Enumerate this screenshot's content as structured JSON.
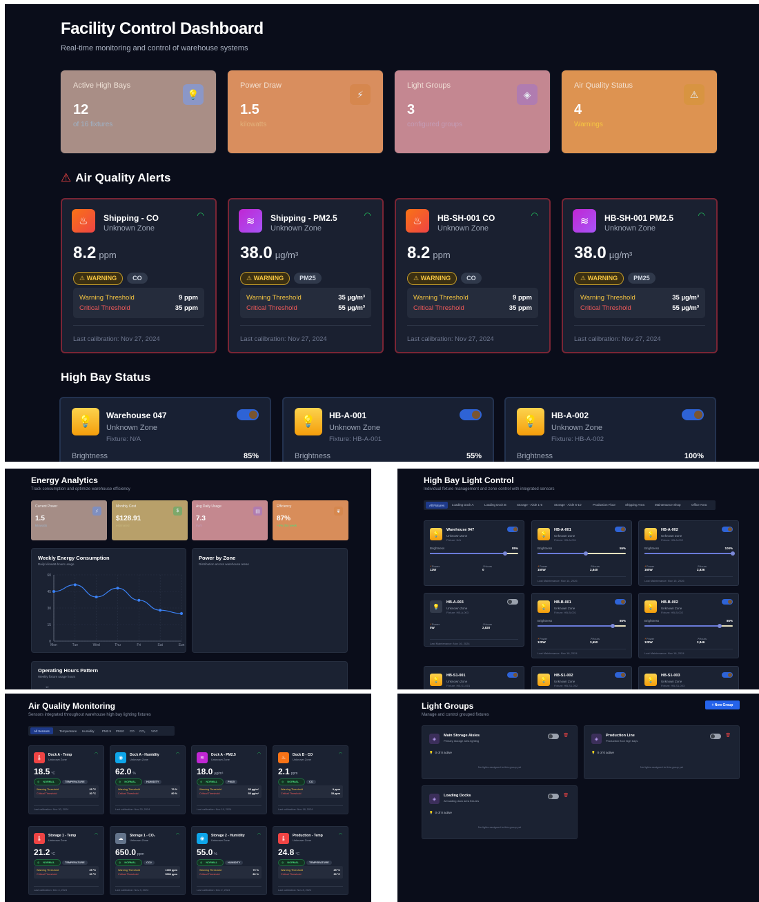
{
  "dashboard": {
    "title": "Facility Control Dashboard",
    "subtitle": "Real-time monitoring and control of warehouse systems",
    "stats": [
      {
        "label": "Active High Bays",
        "value": "12",
        "sub": "of 16 fixtures",
        "icon": "lightbulb-icon",
        "bg": "#a98e86",
        "subColor": "#9fb2c6",
        "iconBg": "#8b97c7"
      },
      {
        "label": "Power Draw",
        "value": "1.5",
        "sub": "kilowatts",
        "icon": "lightning-icon",
        "bg": "#d98e5e",
        "subColor": "#e2b07a",
        "iconBg": "#d6874e"
      },
      {
        "label": "Light Groups",
        "value": "3",
        "sub": "configured groups",
        "icon": "layers-icon",
        "bg": "#c48791",
        "subColor": "#c59cb5",
        "iconBg": "#b07cb0"
      },
      {
        "label": "Air Quality Status",
        "value": "4",
        "sub": "Warnings",
        "icon": "warning-icon",
        "bg": "#dd9351",
        "subColor": "#f5c542",
        "iconBg": "#d89441"
      }
    ]
  },
  "alerts": {
    "title": "Air Quality Alerts",
    "items": [
      {
        "name": "Shipping - CO",
        "zone": "Unknown Zone",
        "value": "8.2",
        "unit": "ppm",
        "status": "WARNING",
        "type": "CO",
        "warn": "9 ppm",
        "crit": "35 ppm",
        "cal": "Last calibration: Nov 27, 2024",
        "kind": "flame"
      },
      {
        "name": "Shipping - PM2.5",
        "zone": "Unknown Zone",
        "value": "38.0",
        "unit": "µg/m³",
        "status": "WARNING",
        "type": "PM25",
        "warn": "35 µg/m³",
        "crit": "55 µg/m³",
        "cal": "Last calibration: Nov 27, 2024",
        "kind": "wind"
      },
      {
        "name": "HB-SH-001 CO",
        "zone": "Unknown Zone",
        "value": "8.2",
        "unit": "ppm",
        "status": "WARNING",
        "type": "CO",
        "warn": "9 ppm",
        "crit": "35 ppm",
        "cal": "Last calibration: Nov 27, 2024",
        "kind": "flame"
      },
      {
        "name": "HB-SH-001 PM2.5",
        "zone": "Unknown Zone",
        "value": "38.0",
        "unit": "µg/m³",
        "status": "WARNING",
        "type": "PM25",
        "warn": "35 µg/m³",
        "crit": "55 µg/m³",
        "cal": "Last calibration: Nov 27, 2024",
        "kind": "wind"
      }
    ],
    "warnLabel": "Warning Threshold",
    "critLabel": "Critical Threshold"
  },
  "highbay": {
    "title": "High Bay Status",
    "brightnessLabel": "Brightness",
    "items": [
      {
        "name": "Warehouse 047",
        "zone": "Unknown Zone",
        "fixture": "Fixture: N/A",
        "brightness": "85%"
      },
      {
        "name": "HB-A-001",
        "zone": "Unknown Zone",
        "fixture": "Fixture: HB-A-001",
        "brightness": "55%"
      },
      {
        "name": "HB-A-002",
        "zone": "Unknown Zone",
        "fixture": "Fixture: HB-A-002",
        "brightness": "100%"
      }
    ]
  },
  "energy": {
    "title": "Energy Analytics",
    "subtitle": "Track consumption and optimize warehouse efficiency",
    "stats": [
      {
        "label": "Current Power",
        "value": "1.5",
        "sub": "kilowatts",
        "bg": "#a58d86",
        "icon": "lightning-icon",
        "iconBg": "#7f8fc0",
        "subColor": "#9fb2c6"
      },
      {
        "label": "Monthly Cost",
        "value": "$128.91",
        "sub": "estimated",
        "bg": "#b8a06a",
        "icon": "dollar-icon",
        "iconBg": "#7da86a",
        "subColor": "#c8b880"
      },
      {
        "label": "Avg Daily Usage",
        "value": "7.3",
        "sub": "kWh",
        "bg": "#c4888f",
        "icon": "chart-icon",
        "iconBg": "#b07cb0",
        "subColor": "#c59cb5"
      },
      {
        "label": "Efficiency",
        "value": "87%",
        "sub": "+5% this week",
        "bg": "#d88d5a",
        "icon": "leaf-icon",
        "iconBg": "#d6874e",
        "subColor": "#4ade80"
      }
    ],
    "weekly": {
      "title": "Weekly Energy Consumption",
      "subtitle": "Daily kilowatt-hours usage"
    },
    "zone": {
      "title": "Power by Zone",
      "subtitle": "Distribution across warehouse areas"
    },
    "hours": {
      "title": "Operating Hours Pattern",
      "subtitle": "Weekly fixture usage hours",
      "tick": "12"
    }
  },
  "chart_data": {
    "type": "line",
    "categories": [
      "Mon",
      "Tue",
      "Wed",
      "Thu",
      "Fri",
      "Sat",
      "Sun"
    ],
    "values": [
      45,
      51,
      40,
      48,
      37,
      28,
      25
    ],
    "yticks": [
      0,
      15,
      30,
      45,
      60
    ],
    "ylim": [
      0,
      60
    ],
    "color": "#3b82f6"
  },
  "control": {
    "title": "High Bay Light Control",
    "subtitle": "Individual fixture management and zone control with integrated sensors",
    "tabs": [
      "All Fixtures",
      "Loading Dock A",
      "Loading Dock B",
      "Storage - Aisle 1-5",
      "Storage - Aisle 6-10",
      "Production Floor",
      "Shipping Area",
      "Maintenance Shop",
      "Office Area"
    ],
    "brightnessLabel": "Brightness",
    "powerLabel": "Power",
    "hoursLabel": "Hours",
    "fixtures": [
      {
        "name": "Warehouse 047",
        "zone": "Unknown Zone",
        "fixture": "Fixture: N/A",
        "on": true,
        "brightness": "85%",
        "level": 0.85,
        "power": "12W",
        "hours": "0",
        "maint": ""
      },
      {
        "name": "HB-A-001",
        "zone": "Unknown Zone",
        "fixture": "Fixture: HB-A-001",
        "on": true,
        "brightness": "55%",
        "level": 0.55,
        "power": "150W",
        "hours": "2,840",
        "maint": "Last Maintenance: Nov 14, 2026"
      },
      {
        "name": "HB-A-002",
        "zone": "Unknown Zone",
        "fixture": "Fixture: HB-A-002",
        "on": true,
        "brightness": "100%",
        "level": 1.0,
        "power": "160W",
        "hours": "2,836",
        "maint": "Last Maintenance: Nov 15, 2026"
      },
      {
        "name": "HB-A-003",
        "zone": "Unknown Zone",
        "fixture": "Fixture: HB-A-003",
        "on": false,
        "brightness": "",
        "level": 0,
        "power": "0W",
        "hours": "2,820",
        "maint": "Last Maintenance: Nov 16, 2024"
      },
      {
        "name": "HB-B-001",
        "zone": "Unknown Zone",
        "fixture": "Fixture: HB-B-001",
        "on": true,
        "brightness": "85%",
        "level": 0.85,
        "power": "128W",
        "hours": "3,650",
        "maint": "Last Maintenance: Nov 18, 2024"
      },
      {
        "name": "HB-B-002",
        "zone": "Unknown Zone",
        "fixture": "Fixture: HB-B-002",
        "on": true,
        "brightness": "85%",
        "level": 0.85,
        "power": "128W",
        "hours": "2,846",
        "maint": "Last Maintenance: Nov 18, 2024"
      },
      {
        "name": "HB-S1-001",
        "zone": "Unknown Zone",
        "fixture": "Fixture: HB-S1-001",
        "on": true,
        "brightness": "",
        "level": 0,
        "power": "",
        "hours": "",
        "maint": ""
      },
      {
        "name": "HB-S1-002",
        "zone": "Unknown Zone",
        "fixture": "Fixture: HB-S1-002",
        "on": true,
        "brightness": "",
        "level": 0,
        "power": "",
        "hours": "",
        "maint": ""
      },
      {
        "name": "HB-S1-003",
        "zone": "Unknown Zone",
        "fixture": "Fixture: HB-S1-003",
        "on": true,
        "brightness": "",
        "level": 0,
        "power": "",
        "hours": "",
        "maint": ""
      }
    ]
  },
  "airq": {
    "title": "Air Quality Monitoring",
    "subtitle": "Sensors integrated throughout warehouse high bay lighting fixtures",
    "tabs": [
      "All Sensors",
      "Temperature",
      "Humidity",
      "PM2.5",
      "PM10",
      "CO",
      "CO₂",
      "VOC"
    ],
    "warnLabel": "Warning Threshold",
    "critLabel": "Critical Threshold",
    "sensors": [
      {
        "name": "Dock A - Temp",
        "zone": "Unknown Zone",
        "value": "18.5",
        "unit": "°C",
        "type": "TEMPERATURE",
        "warn": "25 °C",
        "crit": "30 °C",
        "cal": "Last calibration: Nov 30, 2024",
        "color": "#ef4444",
        "icon": "thermometer-icon"
      },
      {
        "name": "Dock A - Humidity",
        "zone": "Unknown Zone",
        "value": "62.0",
        "unit": "%",
        "type": "HUMIDITY",
        "warn": "70 %",
        "crit": "80 %",
        "cal": "Last calibration: Nov 20, 2024",
        "color": "#0ea5e9",
        "icon": "droplet-icon"
      },
      {
        "name": "Dock A - PM2.5",
        "zone": "Unknown Zone",
        "value": "18.0",
        "unit": "µg/m³",
        "type": "PM25",
        "warn": "35 µg/m³",
        "crit": "55 µg/m³",
        "cal": "Last calibration: Nov 19, 2024",
        "color": "#c026d3",
        "icon": "wind-icon"
      },
      {
        "name": "Dock B - CO",
        "zone": "Unknown Zone",
        "value": "2.1",
        "unit": "ppm",
        "type": "CO",
        "warn": "9 ppm",
        "crit": "35 ppm",
        "cal": "Last calibration: Nov 18, 2024",
        "color": "#f97316",
        "icon": "flame-icon"
      },
      {
        "name": "Storage 1 - Temp",
        "zone": "Unknown Zone",
        "value": "21.2",
        "unit": "°C",
        "type": "TEMPERATURE",
        "warn": "25 °C",
        "crit": "30 °C",
        "cal": "Last calibration: Dec 4, 2024",
        "color": "#ef4444",
        "icon": "thermometer-icon"
      },
      {
        "name": "Storage 1 - CO₂",
        "zone": "Unknown Zone",
        "value": "650.0",
        "unit": "ppm",
        "type": "CO2",
        "warn": "1000 ppm",
        "crit": "5000 ppm",
        "cal": "Last calibration: Nov 3, 2024",
        "color": "#64748b",
        "icon": "cloud-icon"
      },
      {
        "name": "Storage 2 - Humidity",
        "zone": "Unknown Zone",
        "value": "55.0",
        "unit": "%",
        "type": "HUMIDITY",
        "warn": "70 %",
        "crit": "80 %",
        "cal": "Last calibration: Dec 2, 2024",
        "color": "#0ea5e9",
        "icon": "droplet-icon"
      },
      {
        "name": "Production - Temp",
        "zone": "Unknown Zone",
        "value": "24.8",
        "unit": "°C",
        "type": "TEMPERATURE",
        "warn": "25 °C",
        "crit": "30 °C",
        "cal": "Last calibration: Nov 8, 2024",
        "color": "#ef4444",
        "icon": "thermometer-icon"
      }
    ],
    "normal": "NORMAL"
  },
  "groups": {
    "title": "Light Groups",
    "subtitle": "Manage and control grouped fixtures",
    "newButton": "+ New Group",
    "items": [
      {
        "name": "Main Storage Aisles",
        "desc": "Primary storage area lighting",
        "active": "0 of 0 active",
        "empty": "No lights assigned to this group yet"
      },
      {
        "name": "Production Line",
        "desc": "Production floor high bays",
        "active": "0 of 0 active",
        "empty": "No lights assigned to this group yet"
      },
      {
        "name": "Loading Docks",
        "desc": "All loading dock area fixtures",
        "active": "0 of 0 active",
        "empty": "No lights assigned to this group yet"
      }
    ]
  }
}
